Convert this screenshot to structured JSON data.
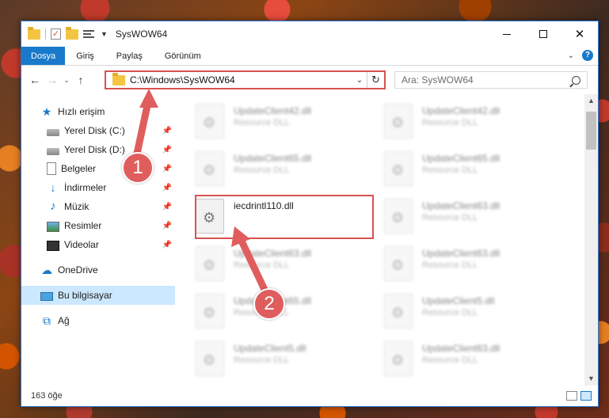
{
  "window": {
    "title": "SysWOW64"
  },
  "ribbon": {
    "tabs": [
      "Dosya",
      "Giriş",
      "Paylaş",
      "Görünüm"
    ]
  },
  "address": {
    "path": "C:\\Windows\\SysWOW64"
  },
  "search": {
    "placeholder": "Ara: SysWOW64"
  },
  "nav": {
    "quick_access": "Hızlı erişim",
    "items": [
      "Yerel Disk (C:)",
      "Yerel Disk (D:)",
      "Belgeler",
      "İndirmeler",
      "Müzik",
      "Resimler",
      "Videolar"
    ],
    "onedrive": "OneDrive",
    "this_pc": "Bu bilgisayar",
    "network": "Ağ"
  },
  "files": {
    "type_label": "Resource DLL",
    "highlighted": "iecdrintl110.dll",
    "col1": [
      "UpdateClient42.dll",
      "UpdateClient65.dll",
      "UpdateClient63.dll",
      "UpdateClient65.dll",
      "UpdateClient5.dll"
    ],
    "col2": [
      "UpdateClient42.dll",
      "UpdateClient65.dll",
      "UpdateClient63.dll",
      "UpdateClient63.dll",
      "UpdateClient5.dll",
      "UpdateClient63.dll"
    ]
  },
  "status": {
    "count": "163 öğe"
  },
  "annotations": {
    "step1": "1",
    "step2": "2",
    "color": "#e05d5d"
  }
}
